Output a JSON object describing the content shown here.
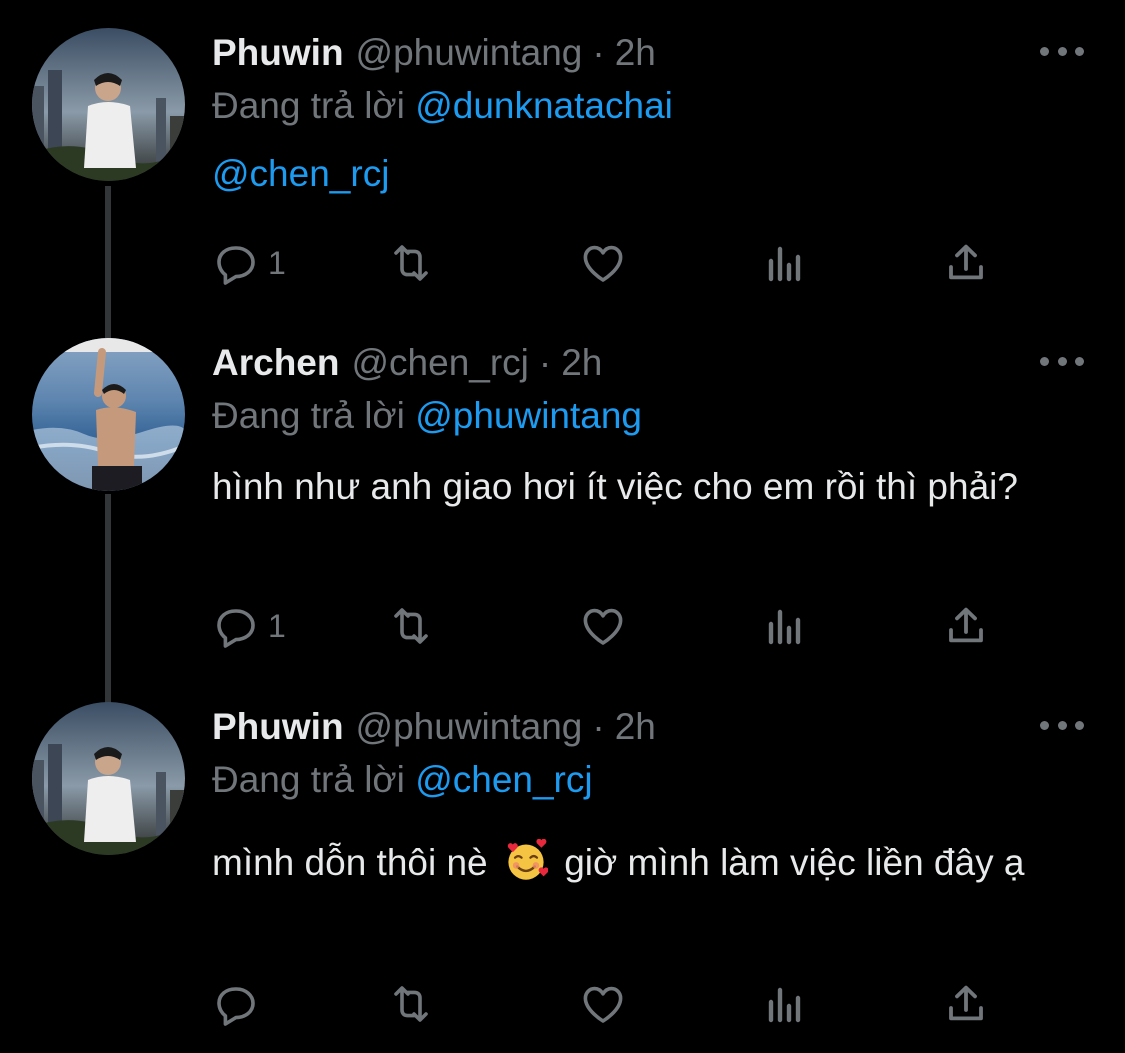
{
  "tweets": [
    {
      "name": "Phuwin",
      "handle": "@phuwintang",
      "dot": "·",
      "time": "2h",
      "reply_prefix": "Đang trả lời",
      "reply_to": "@dunknatachai",
      "body_mention": "@chen_rcj",
      "reply_count": "1"
    },
    {
      "name": "Archen",
      "handle": "@chen_rcj",
      "dot": "·",
      "time": "2h",
      "reply_prefix": "Đang trả lời",
      "reply_to": "@phuwintang",
      "body_text": "hình như anh giao hơi ít việc cho em rồi thì phải?",
      "reply_count": "1"
    },
    {
      "name": "Phuwin",
      "handle": "@phuwintang",
      "dot": "·",
      "time": "2h",
      "reply_prefix": "Đang trả lời",
      "reply_to": "@chen_rcj",
      "body_before_emoji": "mình dỗn thôi nè",
      "emoji_icon": "smiling-face-with-hearts-icon",
      "body_after_emoji": " giờ mình làm việc liền đây ạ",
      "reply_count": ""
    }
  ],
  "colors": {
    "background": "#000000",
    "text": "#e7e9ea",
    "muted": "#71767b",
    "accent": "#1d9bf0",
    "thread_line": "#333639"
  }
}
